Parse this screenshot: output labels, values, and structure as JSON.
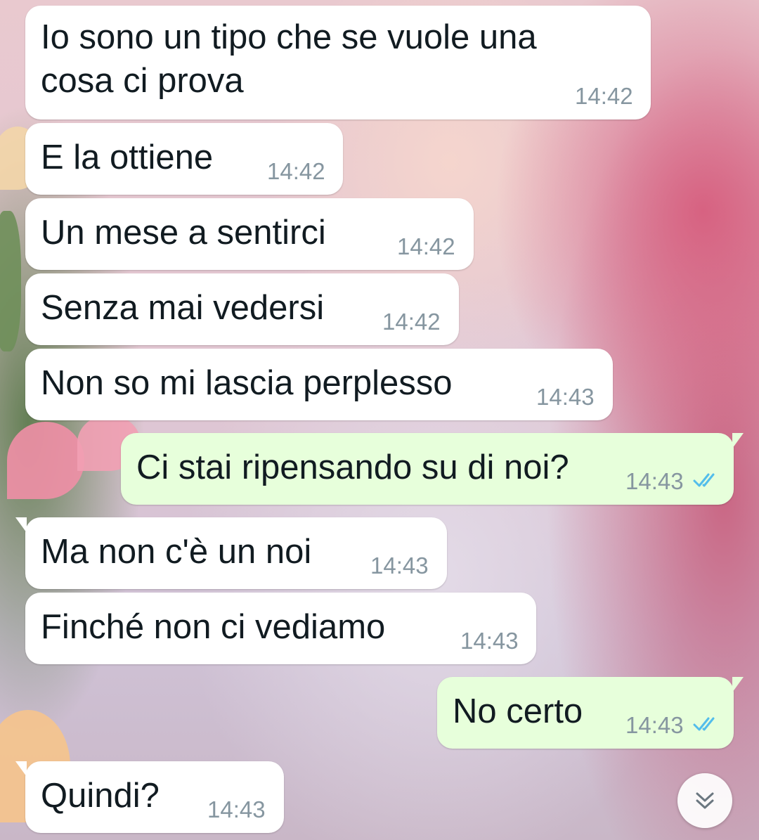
{
  "chat": {
    "messages": [
      {
        "direction": "in",
        "lines": [
          "Io sono un tipo che se vuole una",
          "cosa ci prova"
        ],
        "time": "14:42"
      },
      {
        "direction": "in",
        "lines": [
          "E la ottiene"
        ],
        "time": "14:42"
      },
      {
        "direction": "in",
        "lines": [
          "Un mese a sentirci"
        ],
        "time": "14:42"
      },
      {
        "direction": "in",
        "lines": [
          "Senza mai vedersi"
        ],
        "time": "14:42"
      },
      {
        "direction": "in",
        "lines": [
          "Non so mi lascia perplesso"
        ],
        "time": "14:43"
      },
      {
        "direction": "out",
        "lines": [
          "Ci stai ripensando su di noi?"
        ],
        "time": "14:43",
        "status": "read"
      },
      {
        "direction": "in",
        "lines": [
          "Ma non c'è un noi"
        ],
        "time": "14:43"
      },
      {
        "direction": "in",
        "lines": [
          "Finché non ci vediamo"
        ],
        "time": "14:43"
      },
      {
        "direction": "out",
        "lines": [
          "No certo"
        ],
        "time": "14:43",
        "status": "read"
      },
      {
        "direction": "in",
        "lines": [
          "Quindi?"
        ],
        "time": "14:43"
      }
    ]
  },
  "controls": {
    "scroll_down_icon": "double-chevron-down-icon"
  },
  "colors": {
    "incoming_bubble": "#ffffff",
    "outgoing_bubble": "#e7ffdb",
    "text": "#111b21",
    "timestamp": "#8696a0",
    "read_ticks": "#53bdeb"
  }
}
